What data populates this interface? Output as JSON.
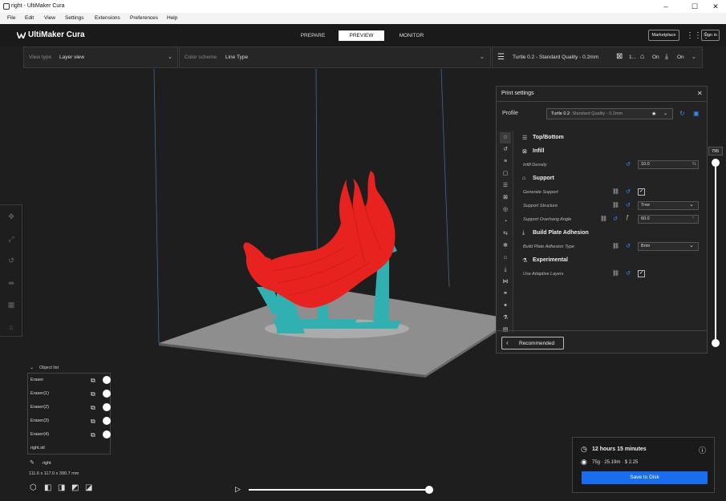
{
  "window": {
    "title": "right - UltiMaker Cura",
    "controls": [
      "–",
      "☐",
      "✕"
    ]
  },
  "menu": [
    "File",
    "Edit",
    "View",
    "Settings",
    "Extensions",
    "Preferences",
    "Help"
  ],
  "header": {
    "logo": "UltiMaker Cura",
    "tabs": [
      {
        "label": "PREPARE",
        "active": false
      },
      {
        "label": "PREVIEW",
        "active": true
      },
      {
        "label": "MONITOR",
        "active": false
      }
    ],
    "marketplace": "Marketplace",
    "signin": "Sign in"
  },
  "toolbar": {
    "view_type_label": "View type",
    "view_type_value": "Layer view",
    "color_scheme_label": "Color scheme",
    "color_scheme_value": "Line Type",
    "profile_summary": "Turtle 0.2 - Standard Quality - 0.2mm",
    "infill_short": "1...",
    "support_state": "On",
    "adhesion_state": "On"
  },
  "print_settings": {
    "title": "Print settings",
    "profile_label": "Profile",
    "profile_name": "Turtle 0.2",
    "profile_detail": " - Standard Quality - 0.2mm",
    "sections": {
      "topbottom": "Top/Bottom",
      "infill": "Infill",
      "support": "Support",
      "adhesion": "Build Plate Adhesion",
      "experimental": "Experimental"
    },
    "settings": {
      "infill_density_label": "Infill Density",
      "infill_density_value": "10.0",
      "infill_density_unit": "%",
      "generate_support_label": "Generate Support",
      "support_structure_label": "Support Structure",
      "support_structure_value": "Tree",
      "overhang_label": "Support Overhang Angle",
      "overhang_value": "60.0",
      "overhang_unit": "°",
      "adhesion_type_label": "Build Plate Adhesion Type",
      "adhesion_type_value": "Brim",
      "adaptive_label": "Use Adaptive Layers"
    },
    "recommended": "Recommended"
  },
  "layer_slider": {
    "top_value": "795"
  },
  "object_list": {
    "header": "Object list",
    "items": [
      "Eraser",
      "Eraser(1)",
      "Eraser(2)",
      "Eraser(3)",
      "Eraser(4)",
      "right.stl"
    ]
  },
  "selection": {
    "name": "right",
    "dimensions": "111.6 x 117.0 x 390.7 mm"
  },
  "estimate": {
    "time": "12 hours 15 minutes",
    "material": "75g · 25.19m · $ 2.25",
    "save": "Save to Disk"
  },
  "colors": {
    "model": "#e8221e",
    "support": "#30b0b0",
    "accent": "#196ef0",
    "plate": "#8a8a8a"
  }
}
